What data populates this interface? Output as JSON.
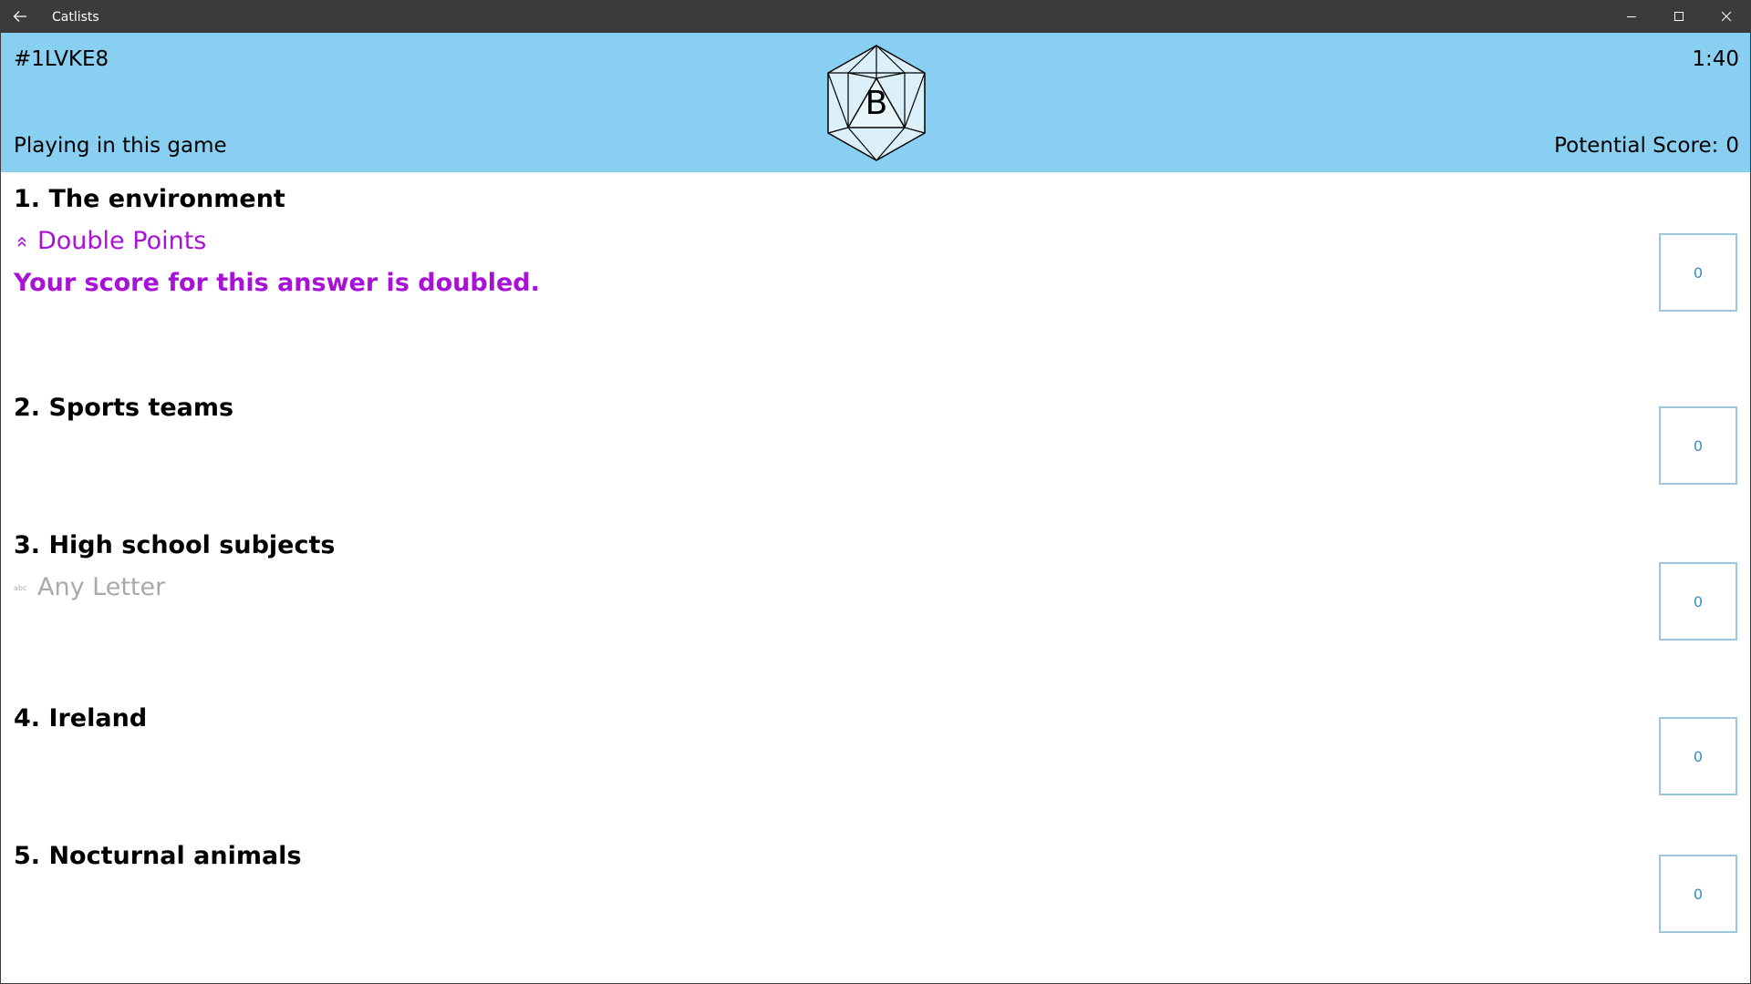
{
  "titlebar": {
    "title": "Catlists",
    "back_icon": "arrow-left-icon",
    "controls": [
      "minimize-icon",
      "maximize-icon",
      "close-icon"
    ]
  },
  "header": {
    "game_code": "#1LVKE8",
    "timer": "1:40",
    "status": "Playing in this game",
    "potential_score_label": "Potential Score:",
    "potential_score_value": "0",
    "die_letter": "B",
    "background_color": "#88cff1"
  },
  "categories": [
    {
      "title": "1. The environment",
      "modifier": "Double Points",
      "modifier_icon": "chevron-double-up-icon",
      "modifier_description": "Your score for this answer is doubled.",
      "score": "0"
    },
    {
      "title": "2. Sports teams",
      "score": "0"
    },
    {
      "title": "3. High school subjects",
      "modifier": "Any Letter",
      "modifier_icon": "abc-icon",
      "score": "0"
    },
    {
      "title": "4. Ireland",
      "score": "0"
    },
    {
      "title": "5. Nocturnal animals",
      "score": "0"
    }
  ],
  "colors": {
    "accent_purple": "#a812d6",
    "muted_gray": "#a9a9a9",
    "score_border": "#9cc6de",
    "score_text": "#3a8dbf",
    "titlebar": "#3b3b3b"
  }
}
